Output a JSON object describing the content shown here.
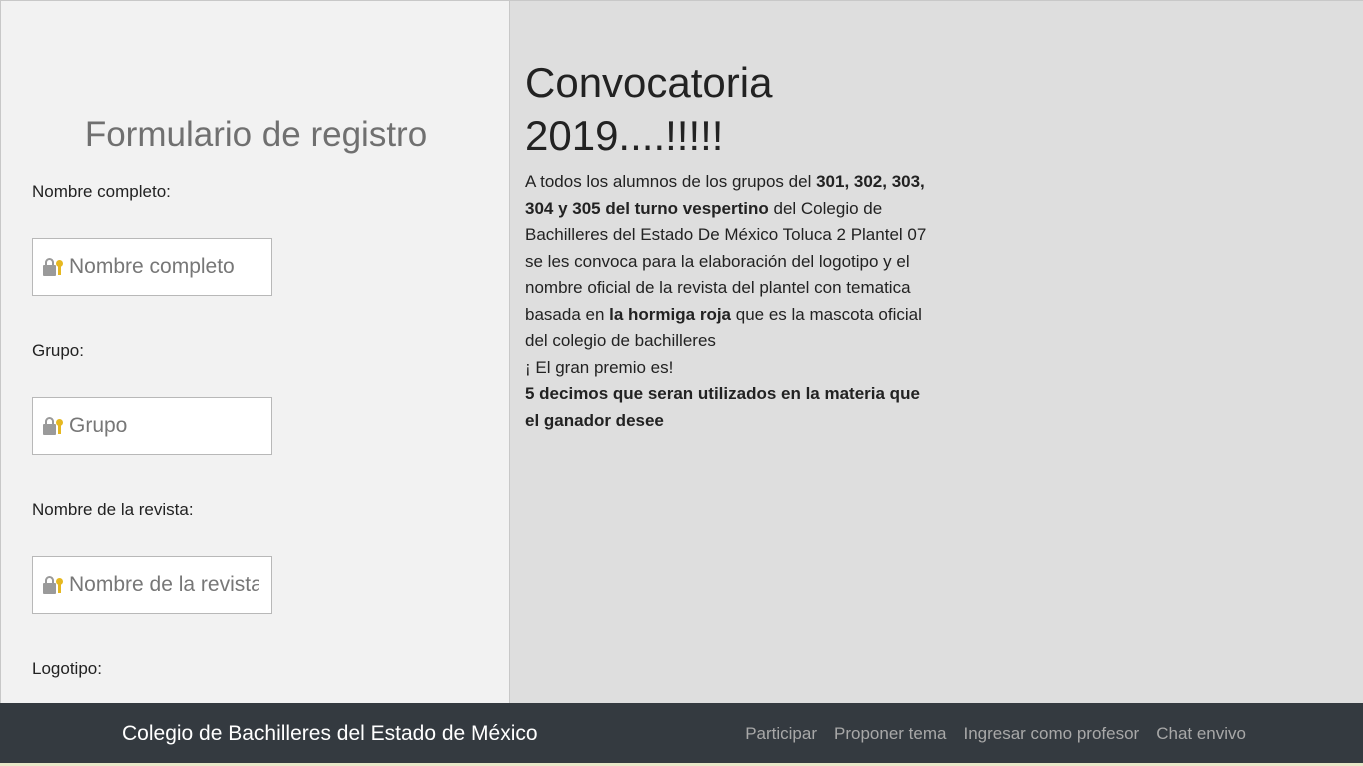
{
  "form": {
    "title": "Formulario de registro",
    "fields": [
      {
        "label": "Nombre completo:",
        "placeholder": "Nombre completo",
        "value": ""
      },
      {
        "label": "Grupo:",
        "placeholder": "Grupo",
        "value": ""
      },
      {
        "label": "Nombre de la revista:",
        "placeholder": "Nombre de la revista",
        "value": ""
      },
      {
        "label": "Logotipo:"
      }
    ],
    "field_icon": "lock-key-icon"
  },
  "announcement": {
    "title_line1": "Convocatoria",
    "title_line2": "2019....!!!!!",
    "p1_a": "A todos los alumnos de los grupos del ",
    "p1_b": "301, 302, 303, 304 y 305 del turno vespertino",
    "p1_c": " del Colegio de Bachilleres del Estado De México Toluca 2 Plantel 07 se les convoca para la elaboración del logotipo y el nombre oficial de la revista del plantel con tematica basada en ",
    "p1_d": "la hormiga roja",
    "p1_e": " que es la mascota oficial del colegio de bachilleres",
    "prize_intro": "¡ El gran premio es!",
    "prize": "5 decimos que seran utilizados en la materia que el ganador desee"
  },
  "footer": {
    "brand": "Colegio de Bachilleres del Estado de México",
    "nav": [
      "Participar",
      "Proponer tema",
      "Ingresar como profesor",
      "Chat envivo"
    ]
  },
  "colors": {
    "footer_bg": "#343a40",
    "left_panel_bg": "#f2f2f2",
    "right_panel_bg": "#dedede",
    "nav_link": "#a8a8a8"
  }
}
